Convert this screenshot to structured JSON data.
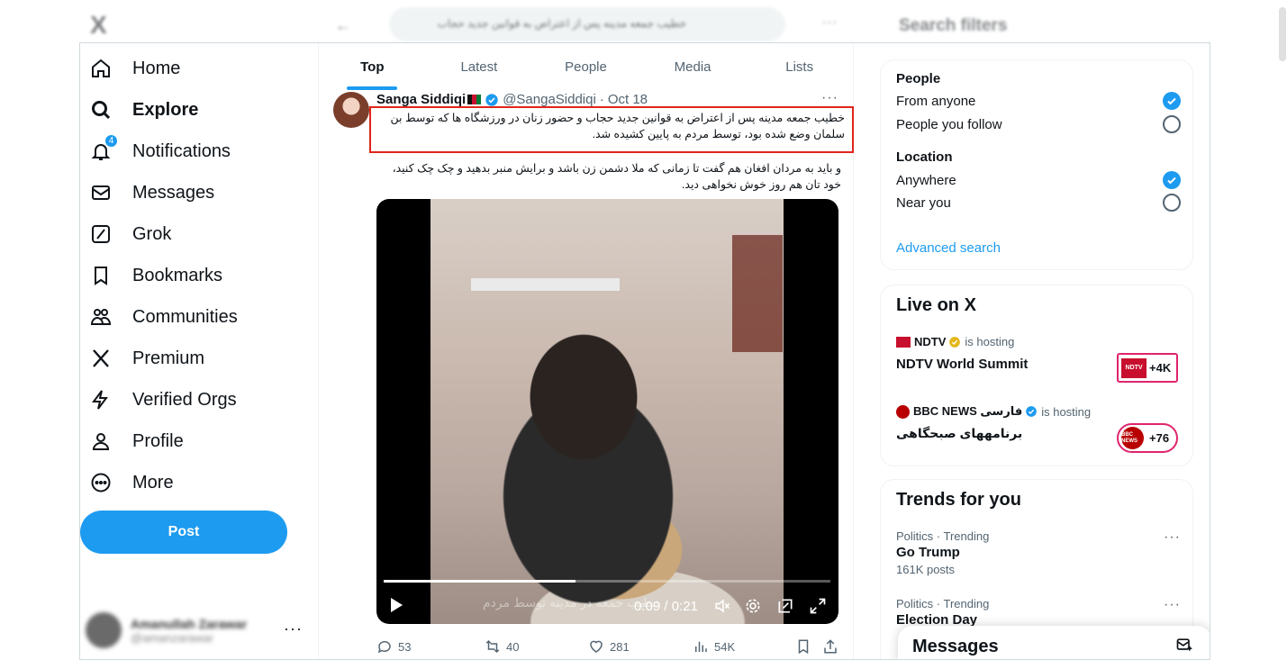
{
  "backdrop": {
    "logo": "X",
    "search_text": "خطیب جمعه مدینه پس از اعتراض به قوانین جدید حجاب",
    "filters_title": "Search filters"
  },
  "nav": {
    "items": [
      {
        "label": "Home",
        "icon": "home-icon"
      },
      {
        "label": "Explore",
        "icon": "search-icon"
      },
      {
        "label": "Notifications",
        "icon": "bell-icon",
        "badge": "4"
      },
      {
        "label": "Messages",
        "icon": "envelope-icon"
      },
      {
        "label": "Grok",
        "icon": "grok-icon"
      },
      {
        "label": "Bookmarks",
        "icon": "bookmark-icon"
      },
      {
        "label": "Communities",
        "icon": "communities-icon"
      },
      {
        "label": "Premium",
        "icon": "x-logo-icon"
      },
      {
        "label": "Verified Orgs",
        "icon": "lightning-icon"
      },
      {
        "label": "Profile",
        "icon": "person-icon"
      },
      {
        "label": "More",
        "icon": "more-circle-icon"
      }
    ],
    "post_label": "Post",
    "account": {
      "name": "Amanullah Zarawar",
      "handle": "@amanzarawar",
      "more": "···"
    }
  },
  "tabs": [
    "Top",
    "Latest",
    "People",
    "Media",
    "Lists"
  ],
  "tweet": {
    "name": "Sanga Siddiqi",
    "handle": "@SangaSiddiqi",
    "dot": "·",
    "date": "Oct 18",
    "more": "···",
    "text1": "خطیب جمعه مدینه پس از اعتراض به قوانین جدید حجاب و حضور زنان در ورزشگاه ها که توسط بن سلمان وضع شده بود، توسط مردم به پایین کشیده شد.",
    "text2": "و باید به مردان افغان هم گفت تا زمانی که ملا دشمن زن باشد و برایش منبر بدهید و چک چک کنید، خود تان هم روز خوش نخواهی دید.",
    "video": {
      "overlay_text": "خطیب جمعه در مدینه توسط مردم",
      "time": "0:09 / 0:21",
      "progress": 0.43
    },
    "actions": {
      "replies": "53",
      "reposts": "40",
      "likes": "281",
      "views": "54K"
    }
  },
  "filters": {
    "people_title": "People",
    "from_anyone": "From anyone",
    "people_you_follow": "People you follow",
    "location_title": "Location",
    "anywhere": "Anywhere",
    "near_you": "Near you",
    "advanced": "Advanced search"
  },
  "live": {
    "title": "Live on X",
    "hosts": [
      {
        "host": "NDTV",
        "hosting": "is hosting",
        "title": "NDTV World Summit",
        "count": "+4K",
        "logo": "NDTV"
      },
      {
        "host": "BBC NEWS فارسی",
        "hosting": "is hosting",
        "title": "برنامههای صبحگاهی",
        "count": "+76",
        "logo": "BBC NEWS"
      }
    ]
  },
  "trends": {
    "title": "Trends for you",
    "items": [
      {
        "context": "Politics · Trending",
        "name": "Go Trump",
        "count": "161K posts"
      },
      {
        "context": "Politics · Trending",
        "name": "Election Day",
        "count": ""
      }
    ]
  },
  "messages_drawer": {
    "title": "Messages"
  },
  "colors": {
    "accent": "#1d9bf0",
    "highlight_box": "#e0251b",
    "badge_border": "#e0246c"
  }
}
